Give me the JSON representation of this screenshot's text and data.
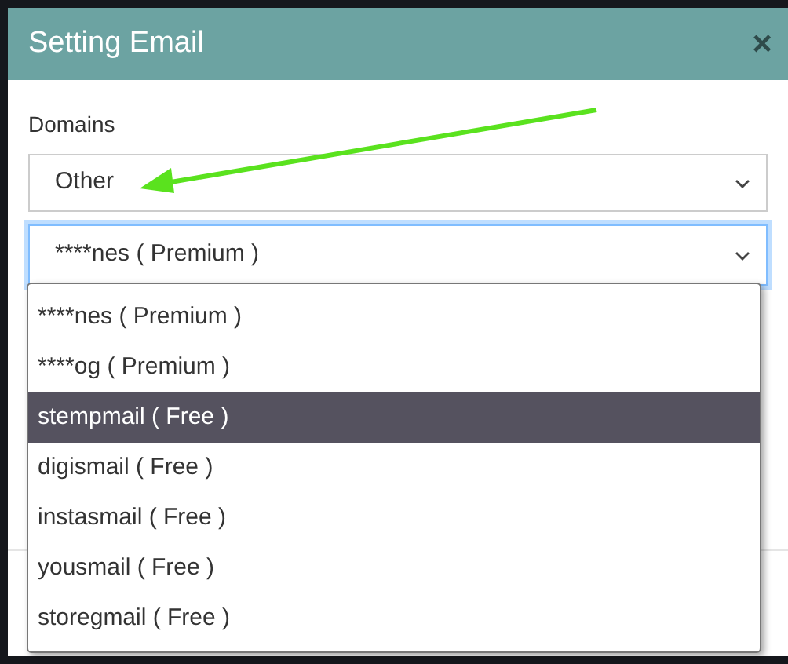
{
  "dialog": {
    "title": "Setting Email",
    "close": "×"
  },
  "domains": {
    "label": "Domains",
    "value": "Other"
  },
  "address_select": {
    "value": "****nes ( Premium )",
    "focused": true,
    "open": true
  },
  "options": [
    {
      "label": "****nes ( Premium )",
      "selected": false
    },
    {
      "label": "****og ( Premium )",
      "selected": false
    },
    {
      "label": "stempmail ( Free )",
      "selected": true
    },
    {
      "label": "digismail ( Free )",
      "selected": false
    },
    {
      "label": "instasmail ( Free )",
      "selected": false
    },
    {
      "label": "yousmail ( Free )",
      "selected": false
    },
    {
      "label": "storegmail ( Free )",
      "selected": false
    }
  ]
}
